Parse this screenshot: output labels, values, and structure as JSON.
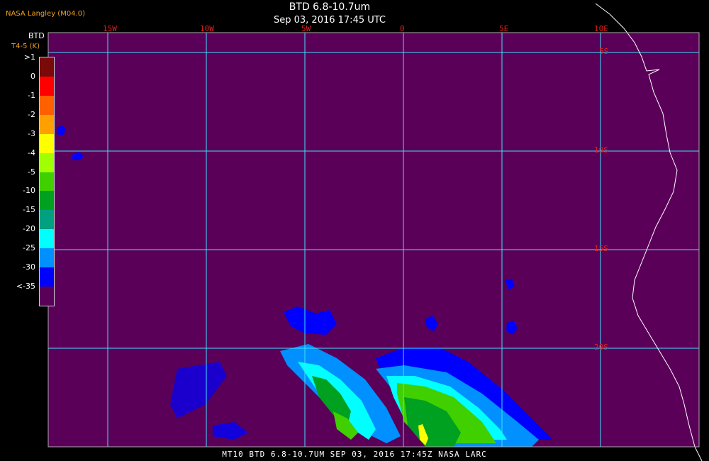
{
  "header": {
    "source": "NASA Langley (M04.0)",
    "title": "BTD 6.8-10.7um",
    "subtitle": "Sep 03, 2016 17:45 UTC"
  },
  "legend": {
    "title": "BTD",
    "subtitle": "T4-5 (K)",
    "items": [
      {
        "label": ">1",
        "color": "#7a0a0a"
      },
      {
        "label": "0",
        "color": "#ff0000"
      },
      {
        "label": "-1",
        "color": "#ff6000"
      },
      {
        "label": "-2",
        "color": "#ffa000"
      },
      {
        "label": "-3",
        "color": "#ffff00"
      },
      {
        "label": "-4",
        "color": "#a0ff00"
      },
      {
        "label": "-5",
        "color": "#40d000"
      },
      {
        "label": "-10",
        "color": "#00a020"
      },
      {
        "label": "-15",
        "color": "#00a080"
      },
      {
        "label": "-20",
        "color": "#00ffff"
      },
      {
        "label": "-25",
        "color": "#0090ff"
      },
      {
        "label": "-30",
        "color": "#0000ff"
      },
      {
        "label": "<-35",
        "color": "#5a0058"
      }
    ]
  },
  "grid": {
    "longitudes": [
      "15W",
      "10W",
      "5W",
      "0",
      "5E",
      "10E"
    ],
    "latitudes": [
      "5S",
      "10S",
      "15S",
      "20S"
    ],
    "line_color": "#40e0ff",
    "background_color": "#5a0058",
    "coast_color": "#ffffff",
    "label_color": "#e02020"
  },
  "footer": {
    "text": "MT10  BTD 6.8-10.7UM   SEP 03, 2016 17:45Z   NASA LARC"
  }
}
